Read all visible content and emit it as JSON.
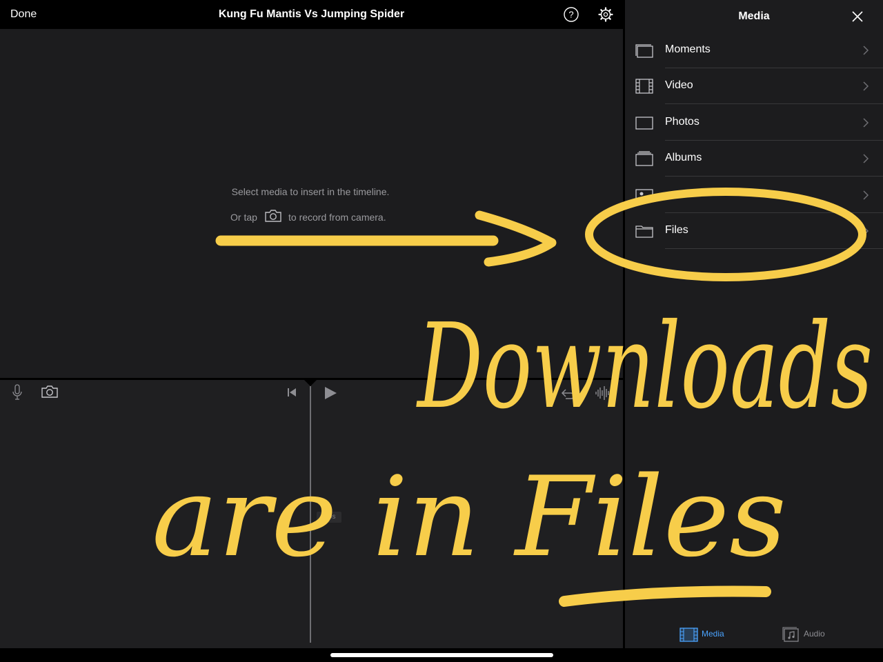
{
  "topbar": {
    "done_label": "Done",
    "project_title": "Kung Fu Mantis Vs Jumping Spider",
    "help_icon": "question-circle-icon",
    "settings_icon": "gear-icon"
  },
  "viewer": {
    "hint_line1": "Select media to insert in the timeline.",
    "hint_or": "Or tap",
    "hint_record": "to record from camera.",
    "camera_icon": "camera-icon"
  },
  "timeline": {
    "time_label": "0.0s",
    "icons": [
      "microphone-icon",
      "camera-icon",
      "skip-back-icon",
      "play-icon",
      "undo-icon",
      "audio-waveform-icon"
    ]
  },
  "media_panel": {
    "title": "Media",
    "close_icon": "close-icon",
    "items": [
      {
        "label": "Moments",
        "icon": "moments-icon"
      },
      {
        "label": "Video",
        "icon": "film-icon"
      },
      {
        "label": "Photos",
        "icon": "photo-icon"
      },
      {
        "label": "Albums",
        "icon": "albums-icon"
      },
      {
        "label": "",
        "icon": "people-album-icon"
      },
      {
        "label": "Files",
        "icon": "folder-icon"
      }
    ],
    "tabs": [
      {
        "label": "Media",
        "icon": "film-strip-icon",
        "selected": true
      },
      {
        "label": "Audio",
        "icon": "music-note-icon",
        "selected": false
      }
    ]
  },
  "annotation": {
    "lines": [
      "Downloads",
      "are in Files"
    ],
    "color": "#f7cd4a"
  },
  "colors": {
    "accent": "#4aa3ff",
    "annotation": "#f7cd4a",
    "panel_bg": "#1c1c1e",
    "viewer_bg": "#1c1c1e"
  }
}
